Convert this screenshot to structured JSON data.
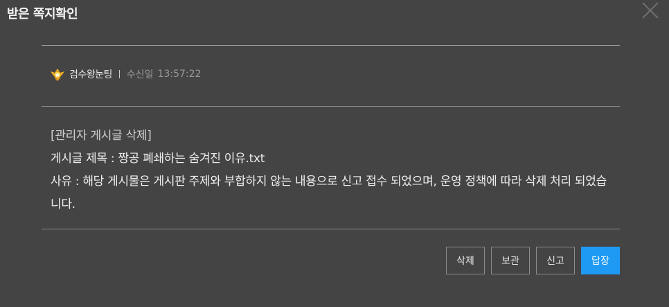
{
  "modal": {
    "title": "받은 쪽지확인",
    "close_icon": "close-icon"
  },
  "sender": {
    "rank_icon": "rank-badge-icon",
    "name": "검수왕눈팅",
    "received_label": "수신일",
    "received_time": "13:57:22"
  },
  "message": {
    "line_header": "[관리자 게시글 삭제]",
    "line_title": "게시글 제목 : 짱공 폐쇄하는 숨겨진 이유.txt",
    "line_reason": "사유 : 해당 게시물은 게시판 주제와 부합하지 않는 내용으로 신고 접수 되었으며, 운영 정책에 따라 삭제 처리 되었습니다."
  },
  "buttons": {
    "delete_label": "삭제",
    "keep_label": "보관",
    "report_label": "신고",
    "reply_label": "답장"
  },
  "colors": {
    "background": "#444444",
    "accent": "#1e9af5"
  }
}
